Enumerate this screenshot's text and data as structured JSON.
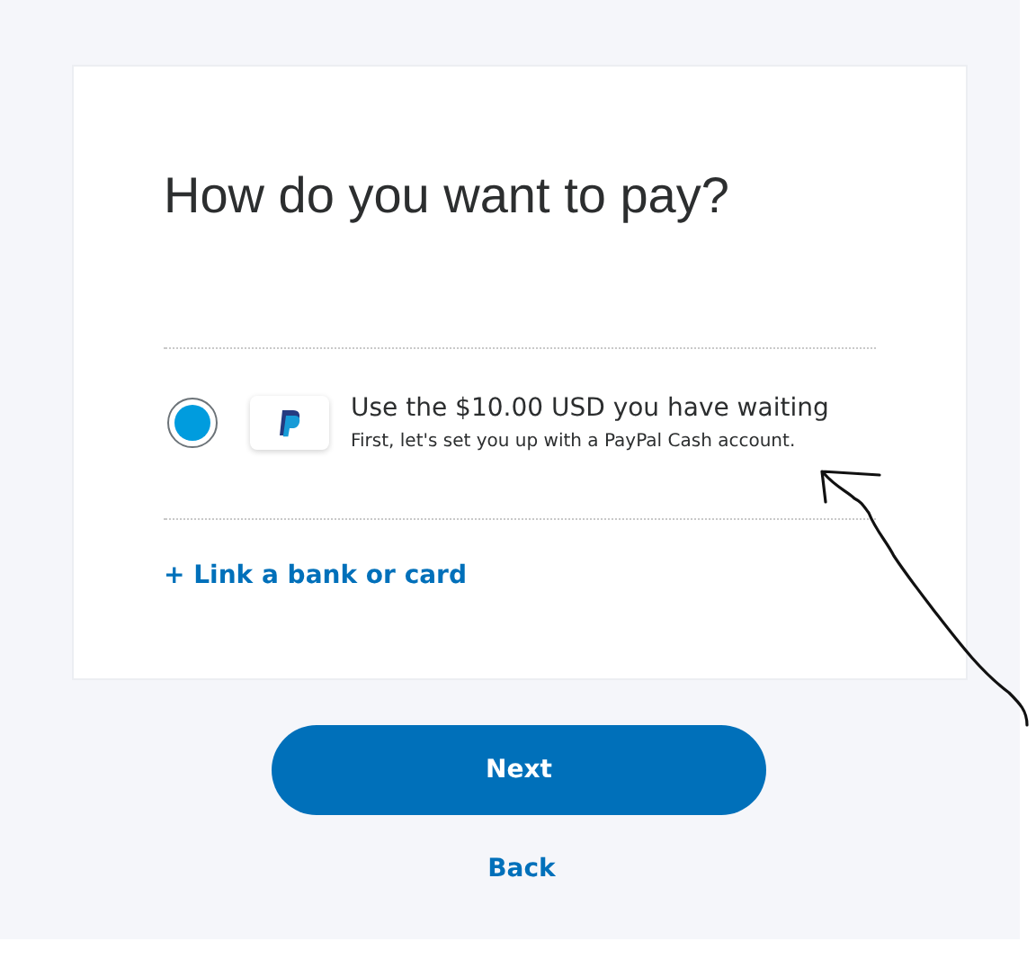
{
  "heading": "How do you want to pay?",
  "payment_options": [
    {
      "selected": true,
      "title": "Use the $10.00 USD you have waiting",
      "subtitle": "First, let's set you up with a PayPal Cash account."
    }
  ],
  "add_link": "+ Link a bank or card",
  "next_button": "Next",
  "back_link": "Back"
}
